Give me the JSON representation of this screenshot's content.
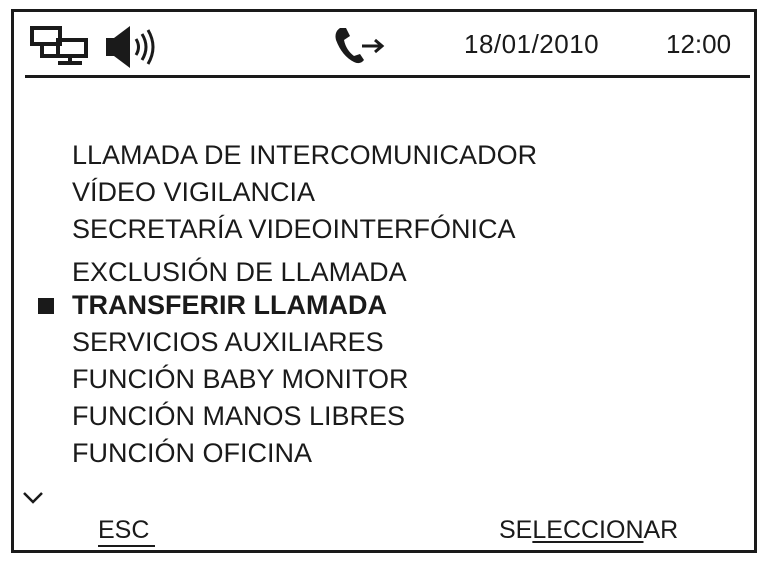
{
  "status": {
    "icons": [
      "intercom-network-icon",
      "speaker-volume-icon",
      "call-transfer-icon"
    ],
    "date": "18/01/2010",
    "time": "12:00"
  },
  "menu": {
    "items": [
      {
        "label": "LLAMADA DE INTERCOMUNICADOR",
        "selected": false
      },
      {
        "label": "VÍDEO VIGILANCIA",
        "selected": false
      },
      {
        "label": "SECRETARÍA VIDEOINTERFÓNICA",
        "selected": false
      },
      {
        "label": "EXCLUSIÓN DE LLAMADA",
        "selected": false
      },
      {
        "label": "TRANSFERIR LLAMADA",
        "selected": true
      },
      {
        "label": "SERVICIOS AUXILIARES",
        "selected": false
      },
      {
        "label": "FUNCIÓN BABY MONITOR",
        "selected": false
      },
      {
        "label": "FUNCIÓN MANOS LIBRES",
        "selected": false
      },
      {
        "label": "FUNCIÓN OFICINA",
        "selected": false
      }
    ]
  },
  "softkeys": {
    "left": "ESC",
    "right_prefix": "SE",
    "right_underlined": "LECCION",
    "right_suffix": "AR"
  }
}
